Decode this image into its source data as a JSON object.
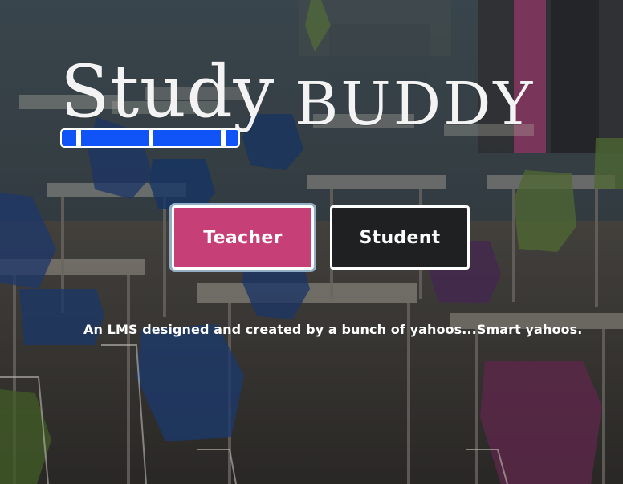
{
  "brand": {
    "study": "Study",
    "buddy": "BUDDY"
  },
  "actions": {
    "teacher": "Teacher",
    "student": "Student"
  },
  "tagline": "An LMS designed and created by a bunch of yahoos...Smart yahoos.",
  "colors": {
    "teacher_button": "#c63f76",
    "student_button": "#1f2022",
    "ruler": "#1054f8"
  }
}
